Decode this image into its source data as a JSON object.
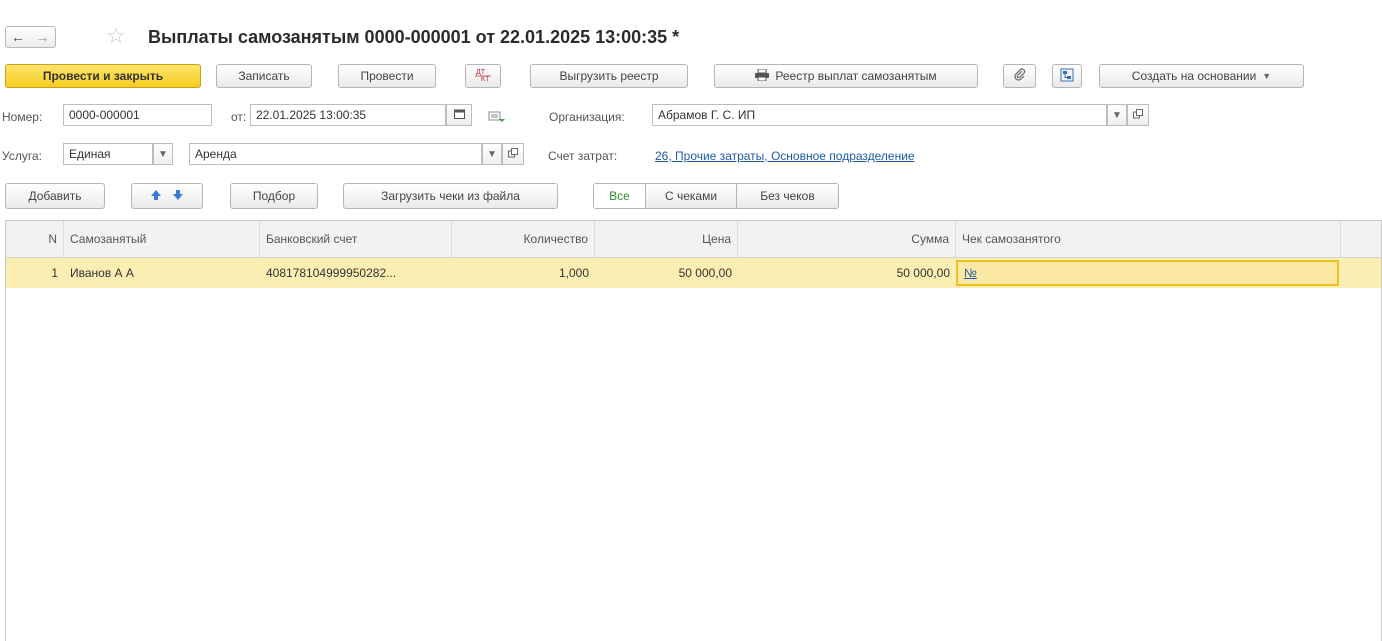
{
  "window": {
    "title": "Выплаты самозанятым 0000-000001 от 22.01.2025 13:00:35 *"
  },
  "nav": {
    "back_glyph": "←",
    "forward_glyph": "→",
    "star_glyph": "☆"
  },
  "toolbar": {
    "post_close": "Провести и закрыть",
    "save": "Записать",
    "post": "Провести",
    "dtkt_label": "ДТ КТ",
    "export_registry": "Выгрузить реестр",
    "registry_report": "Реестр выплат самозанятым",
    "create_based_on": "Создать на основании"
  },
  "form": {
    "number_label": "Номер:",
    "number_value": "0000-000001",
    "date_label": "от:",
    "date_value": "22.01.2025 13:00:35",
    "org_label": "Организация:",
    "org_value": "Абрамов Г. С. ИП",
    "service_label": "Услуга:",
    "service_type": "Единая",
    "service_value": "Аренда",
    "cost_account_label": "Счет затрат:",
    "cost_account_value": "26, Прочие затраты, Основное подразделение"
  },
  "table_toolbar": {
    "add": "Добавить",
    "pick": "Подбор",
    "load_receipts": "Загрузить чеки из файла",
    "filters": [
      "Все",
      "С чеками",
      "Без чеков"
    ],
    "active_filter": "Все"
  },
  "table": {
    "columns": [
      "N",
      "Самозанятый",
      "Банковский счет",
      "Количество",
      "Цена",
      "Сумма",
      "Чек самозанятого"
    ],
    "rows": [
      {
        "n": "1",
        "person": "Иванов А А",
        "account": "408178104999950282...",
        "qty": "1,000",
        "price": "50 000,00",
        "sum": "50 000,00",
        "receipt": "№"
      }
    ]
  },
  "icons": {
    "calendar": "calendar-icon",
    "attach": "paperclip-icon",
    "structure": "structure-icon",
    "printer": "printer-icon",
    "up": "arrow-up-icon",
    "down": "arrow-down-icon"
  },
  "colors": {
    "primary_button": "#f5cd20",
    "selected_row": "#fbeeb3",
    "link": "#1e5ba8",
    "active_filter_text": "#2e8b2e"
  }
}
